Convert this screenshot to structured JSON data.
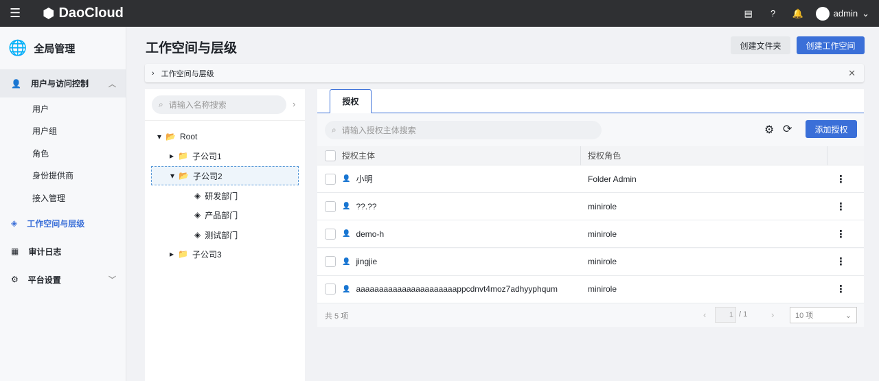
{
  "topbar": {
    "brand": "DaoCloud",
    "user": "admin"
  },
  "sidebar": {
    "header": "全局管理",
    "items": [
      {
        "label": "用户与访问控制",
        "children": [
          "用户",
          "用户组",
          "角色",
          "身份提供商",
          "接入管理"
        ]
      },
      {
        "label": "工作空间与层级"
      },
      {
        "label": "审计日志"
      },
      {
        "label": "平台设置"
      }
    ]
  },
  "page": {
    "title": "工作空间与层级",
    "create_folder": "创建文件夹",
    "create_workspace": "创建工作空间",
    "breadcrumb": "工作空间与层级"
  },
  "tree": {
    "search_placeholder": "请输入名称搜索",
    "nodes": [
      "Root",
      "子公司1",
      "子公司2",
      "研发部门",
      "产品部门",
      "测试部门",
      "子公司3"
    ]
  },
  "main": {
    "tab": "授权",
    "search_placeholder": "请输入授权主体搜索",
    "add_button": "添加授权",
    "columns": [
      "授权主体",
      "授权角色"
    ],
    "rows": [
      {
        "subject": "小明",
        "role": "Folder Admin"
      },
      {
        "subject": "??.??",
        "role": "minirole"
      },
      {
        "subject": "demo-h",
        "role": "minirole"
      },
      {
        "subject": "jingjie",
        "role": "minirole"
      },
      {
        "subject": "aaaaaaaaaaaaaaaaaaaaaappcdnvt4moz7adhyyphqum",
        "role": "minirole"
      }
    ],
    "total": "共 5 项",
    "page": "1",
    "pages": "/ 1",
    "page_size": "10 项"
  },
  "colors": {
    "accent": "#3a6fd8",
    "topbar": "#2f3033"
  }
}
